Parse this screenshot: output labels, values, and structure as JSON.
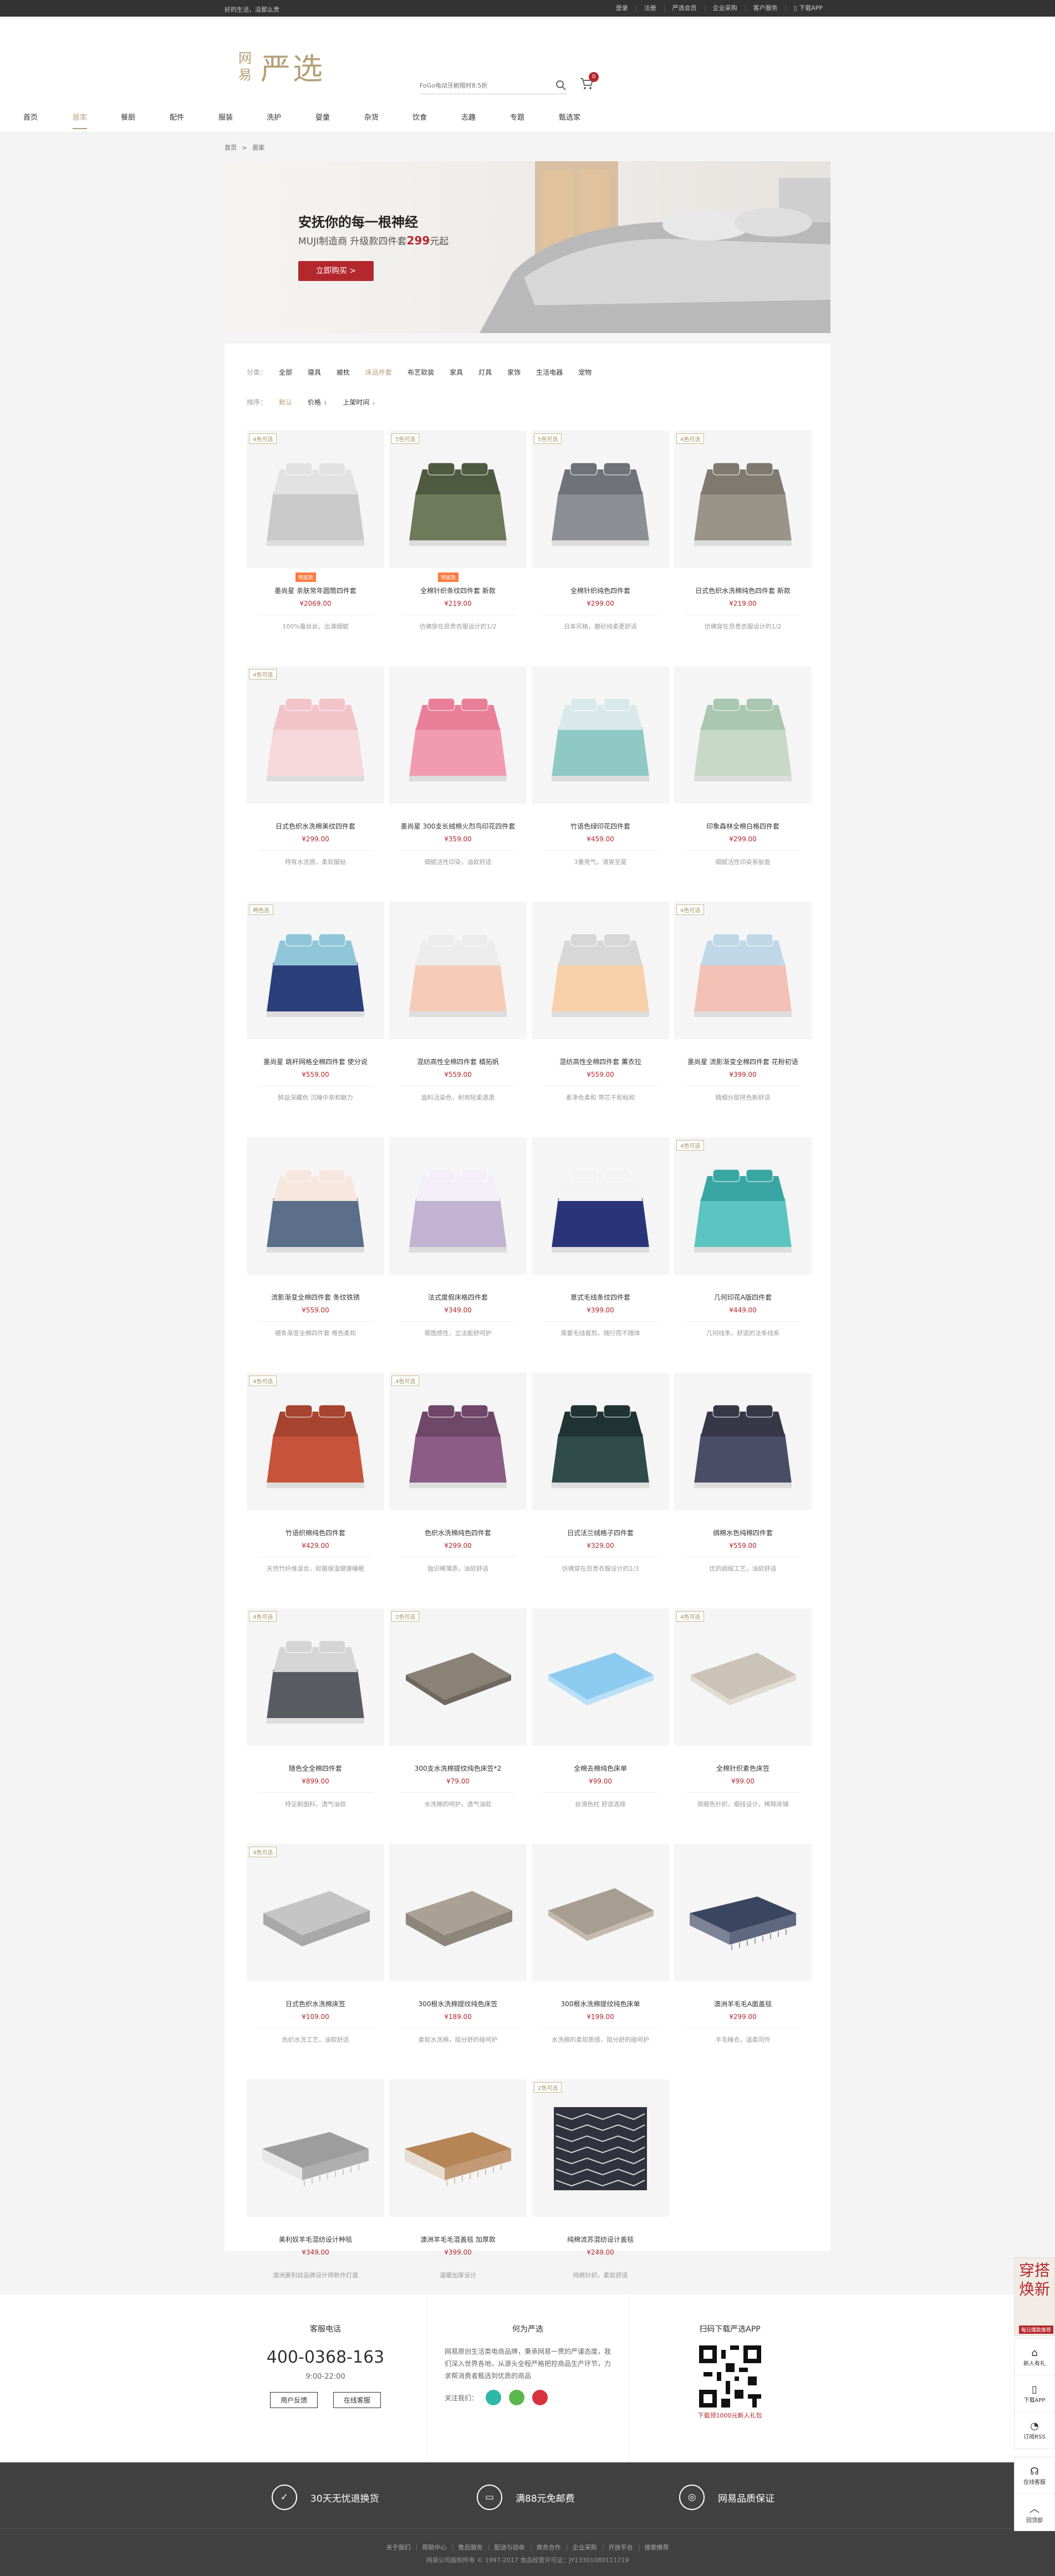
{
  "topbar": {
    "slogan": "好的生活，没那么贵",
    "links": [
      "登录",
      "注册",
      "严选会员",
      "企业采购",
      "客户服务",
      "下载APP"
    ]
  },
  "header": {
    "logo_small_1": "网",
    "logo_small_2": "易",
    "logo_big": "严选",
    "search_placeholder": "FoGo电动牙刷限时8.5折",
    "cart_count": "0"
  },
  "nav": {
    "items": [
      "首页",
      "居家",
      "餐厨",
      "配件",
      "服装",
      "洗护",
      "婴童",
      "杂货",
      "饮食",
      "志趣",
      "专题",
      "甄选家"
    ],
    "active_index": 1
  },
  "breadcrumb": {
    "home": "首页",
    "sep": ">",
    "current": "居家"
  },
  "banner": {
    "title": "安抚你的每一根神经",
    "sub_prefix": "MUJI制造商 升级款四件套",
    "sub_price": "299",
    "sub_suffix": "元起",
    "button": "立即购买 >"
  },
  "filters": {
    "category_label": "分类：",
    "categories": [
      "全部",
      "寝具",
      "被枕",
      "床品件套",
      "布艺软装",
      "家具",
      "灯具",
      "家饰",
      "生活电器",
      "宠物"
    ],
    "active_category": 3,
    "sort_label": "排序：",
    "sorts": [
      "默认",
      "价格",
      "上架时间"
    ],
    "active_sort": 0
  },
  "products": [
    {
      "tag": "4色可选",
      "badge": "明星款",
      "name": "墨尚星 亲肤常年圆筒四件套",
      "price": "¥2069.00",
      "desc": "100%蚕丝丝，出演细腻"
    },
    {
      "tag": "5色可选",
      "badge": "明星款",
      "name": "全棉针织条纹四件套 新款",
      "price": "¥219.00",
      "desc": "仿佛穿在昂贵衣服设计的1/2"
    },
    {
      "tag": "5色可选",
      "badge": "",
      "name": "全棉针织纯色四件套",
      "price": "¥299.00",
      "desc": "日本风格，磨砂纯柔更舒适"
    },
    {
      "tag": "4色可选",
      "badge": "",
      "name": "日式色织水洗棉纯色四件套 新款",
      "price": "¥219.00",
      "desc": "仿佛穿在昂贵衣服设计的1/2"
    },
    {
      "tag": "4色可选",
      "badge": "",
      "name": "日式色织水洗棉美纹四件套",
      "price": "¥299.00",
      "desc": "特有水洗感，柔软服帖"
    },
    {
      "tag": "",
      "badge": "",
      "name": "墨尚星 300支长绒棉火烈鸟印花四件套",
      "price": "¥359.00",
      "desc": "细腻活性印染，油软舒适"
    },
    {
      "tag": "",
      "badge": "",
      "name": "竹语色绿印花四件套",
      "price": "¥459.00",
      "desc": "3重亮气，清爽至夏"
    },
    {
      "tag": "",
      "badge": "",
      "name": "印象森林全棉白格四件套",
      "price": "¥299.00",
      "desc": "细腻活性印染亲肤面"
    },
    {
      "tag": "两色选",
      "badge": "",
      "name": "墨尚星 跳杆网格全棉四件套 使分说",
      "price": "¥559.00",
      "desc": "醉益深藏色 沉睡中亲和魅力"
    },
    {
      "tag": "",
      "badge": "",
      "name": "混纺高性全棉四件套 橘拓帆",
      "price": "¥559.00",
      "desc": "面料活染色，耐用轻柔透透"
    },
    {
      "tag": "",
      "badge": "",
      "name": "混纺高性全棉四件套 薰衣拉",
      "price": "¥559.00",
      "desc": "素净色柔和 带芯干和帖和"
    },
    {
      "tag": "4色可选",
      "badge": "",
      "name": "墨尚星 流影渐变全棉四件套 花粉初语",
      "price": "¥399.00",
      "desc": "精细分层拼色新舒适"
    },
    {
      "tag": "",
      "badge": "",
      "name": "流影渐变全棉四件套 条纹铁锈",
      "price": "¥559.00",
      "desc": "绷条渐变全棉四件套 唯色柔和"
    },
    {
      "tag": "",
      "badge": "",
      "name": "法式度假床格四件套",
      "price": "¥349.00",
      "desc": "需图感性，立法能舒呵护"
    },
    {
      "tag": "",
      "badge": "",
      "name": "意式毛线条纹四件套",
      "price": "¥399.00",
      "desc": "需要毛线裁剪，随行而不随体"
    },
    {
      "tag": "4色可选",
      "badge": "",
      "name": "几何印花A版四件套",
      "price": "¥449.00",
      "desc": "几何线条，舒适的法条线系"
    },
    {
      "tag": "4色可选",
      "badge": "",
      "name": "竹语织棉纯色四件套",
      "price": "¥429.00",
      "desc": "天然竹纤维混合，抑菌保湿健康睡眠"
    },
    {
      "tag": "4色可选",
      "badge": "",
      "name": "色织水洗棉纯色四件套",
      "price": "¥299.00",
      "desc": "独识稀薄质，油软舒适"
    },
    {
      "tag": "",
      "badge": "",
      "name": "日式法兰绒格子四件套",
      "price": "¥329.00",
      "desc": "仿佛穿在昂贵衣服设计的1/3"
    },
    {
      "tag": "",
      "badge": "",
      "name": "绸棉水色纯棉四件套",
      "price": "¥559.00",
      "desc": "优的绸缎工艺，油软舒适"
    },
    {
      "tag": "4色可选",
      "badge": "",
      "name": "随色全全棉四件套",
      "price": "¥899.00",
      "desc": "特足刷面料，透气油软"
    },
    {
      "tag": "2色可选",
      "badge": "",
      "name": "300支水洗棉提纹纯色床笠*2",
      "price": "¥79.00",
      "desc": "水洗棉的呵护，透气油软"
    },
    {
      "tag": "",
      "badge": "",
      "name": "全棉去棉纯色床单",
      "price": "¥99.00",
      "desc": "丝滑色柱 舒适选择"
    },
    {
      "tag": "4色可选",
      "badge": "",
      "name": "全棉针织素色床笠",
      "price": "¥99.00",
      "desc": "亮眼色针织，细线设计，稀释床铺"
    },
    {
      "tag": "4色可选",
      "badge": "",
      "name": "日式色织水洗棉床笠",
      "price": "¥109.00",
      "desc": "色织水洗工艺，油软舒适"
    },
    {
      "tag": "",
      "badge": "",
      "name": "300根水洗棉提纹纯色床笠",
      "price": "¥189.00",
      "desc": "柔软水洗棉，阻分舒的碰呵护"
    },
    {
      "tag": "",
      "badge": "",
      "name": "300根水洗棉提纹纯色床单",
      "price": "¥199.00",
      "desc": "水洗棉的柔软质感，阻分舒的碰呵护"
    },
    {
      "tag": "",
      "badge": "",
      "name": "澳洲羊毛毛A面盖毯",
      "price": "¥299.00",
      "desc": "羊毛睡衣，温柔同件"
    },
    {
      "tag": "",
      "badge": "",
      "name": "美利奴羊毛混纺设计种毯",
      "price": "¥349.00",
      "desc": "澳洲美利奴品牌设计师新作打造"
    },
    {
      "tag": "",
      "badge": "",
      "name": "澳洲羊毛毛混盖毯 加厚款",
      "price": "¥399.00",
      "desc": "温暖加厚设计"
    },
    {
      "tag": "2色可选",
      "badge": "",
      "name": "纯棉流苏混纺设计盖毯",
      "price": "¥249.00",
      "desc": "纯棉针织，柔软舒适"
    }
  ],
  "product_colors": [
    {
      "base": "#c9c9c9",
      "top": "#e2e2e2",
      "style": "duvet"
    },
    {
      "base": "#6e7a5a",
      "top": "#4f5a40",
      "style": "duvet"
    },
    {
      "base": "#8b8e93",
      "top": "#6f7278",
      "style": "duvet"
    },
    {
      "base": "#9a9488",
      "top": "#7e7a70",
      "style": "duvet"
    },
    {
      "base": "#f6d8dc",
      "top": "#f2c4ca",
      "style": "duvet"
    },
    {
      "base": "#f29bb0",
      "top": "#e97f98",
      "style": "duvet"
    },
    {
      "base": "#8fc9c6",
      "top": "#d9e9ea",
      "style": "duvet"
    },
    {
      "base": "#c8d9c8",
      "top": "#a9c7b1",
      "style": "duvet"
    },
    {
      "base": "#2a3f7c",
      "top": "#8fc7d9",
      "style": "duvet"
    },
    {
      "base": "#f5cbb8",
      "top": "#ececec",
      "style": "duvet"
    },
    {
      "base": "#f7d0a9",
      "top": "#d7d7d7",
      "style": "duvet"
    },
    {
      "base": "#f3c0b5",
      "top": "#bfd8e7",
      "style": "duvet"
    },
    {
      "base": "#5b6f8a",
      "top": "#f7e7df",
      "style": "duvet"
    },
    {
      "base": "#c1b3d1",
      "top": "#f3eef7",
      "style": "duvet"
    },
    {
      "base": "#2a3579",
      "top": "#f4f4f4",
      "style": "duvet"
    },
    {
      "base": "#5cc4c0",
      "top": "#3aa6a3",
      "style": "duvet"
    },
    {
      "base": "#c7543a",
      "top": "#a64430",
      "style": "duvet"
    },
    {
      "base": "#8c5c86",
      "top": "#6f4769",
      "style": "duvet"
    },
    {
      "base": "#2f4c4b",
      "top": "#1f3332",
      "style": "duvet"
    },
    {
      "base": "#4a4d66",
      "top": "#363848",
      "style": "duvet"
    },
    {
      "base": "#5a5c64",
      "top": "#d5d5d5",
      "style": "duvet"
    },
    {
      "base": "#8a8177",
      "top": "#6f675e",
      "style": "flat"
    },
    {
      "base": "#8dcaf0",
      "top": "#b9e0f7",
      "style": "flat"
    },
    {
      "base": "#ccc3b8",
      "top": "#e2dbd1",
      "style": "flat"
    },
    {
      "base": "#a8a8a8",
      "top": "#c5c5c5",
      "style": "fold"
    },
    {
      "base": "#8d857a",
      "top": "#aaa194",
      "style": "fold"
    },
    {
      "base": "#a89d91",
      "top": "#c4b9ad",
      "style": "flat"
    },
    {
      "base": "#3a4560",
      "top": "#7c8396",
      "style": "throw"
    },
    {
      "base": "#9d9d9d",
      "top": "#e8e8e8",
      "style": "throw"
    },
    {
      "base": "#b58556",
      "top": "#e5ddd1",
      "style": "throw"
    },
    {
      "base": "#30333d",
      "top": "#d9d9d9",
      "style": "rug"
    }
  ],
  "footer": {
    "hotline_title": "客服电话",
    "hotline_number": "400-0368-163",
    "hotline_hours": "9:00-22:00",
    "btn_feedback": "用户反馈",
    "btn_online": "在线客服",
    "about_title": "何为严选",
    "about_text": "网易原创生活类电商品牌，秉承网易一贯的严谨态度，我们深入世界各地，从源头全程严格把控商品生产环节，力求帮消费者甄选到优质的商品",
    "follow_label": "关注我们：",
    "app_title": "扫码下载严选APP",
    "app_caption": "下载领1000元新人礼包",
    "promises": [
      "30天无忧退换货",
      "满88元免邮费",
      "网易品质保证"
    ],
    "links": [
      "关于我们",
      "帮助中心",
      "售后服务",
      "配送与验收",
      "商务合作",
      "企业采购",
      "开放平台",
      "搜索推荐"
    ],
    "copyright": "网易公司版权所有 © 1997-2017   食品经营许可证：JY13301080111719"
  },
  "side": {
    "ad_line1": "穿搭",
    "ad_line2": "焕新",
    "ad_sub": "每日爆款推荐",
    "items": [
      "新人有礼",
      "在线客服",
      "下载APP",
      "订阅RSS",
      "回顶部"
    ]
  }
}
